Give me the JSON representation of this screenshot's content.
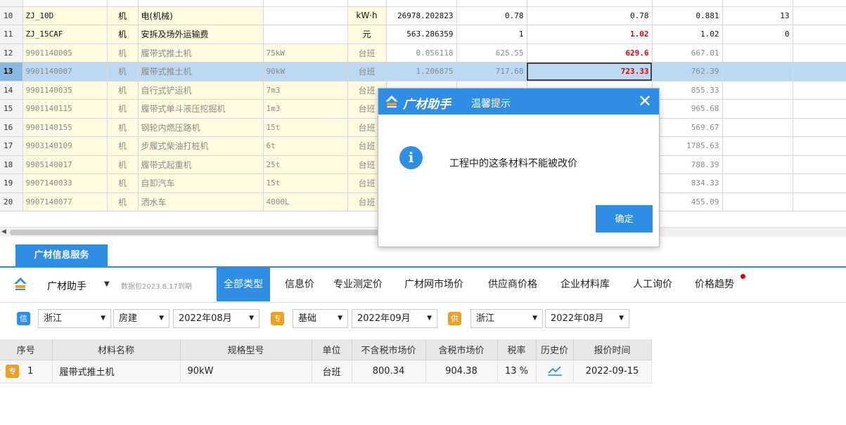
{
  "grid": {
    "rows": [
      {
        "no": "10",
        "code": "ZJ_10D",
        "cat": "机",
        "name": "电(机械)",
        "spec": "",
        "unit": "kW·h",
        "qty": "26978.202823",
        "p1": "0.78",
        "p2": "0.78",
        "p3": "0.881",
        "p4": "13"
      },
      {
        "no": "11",
        "code": "ZJ_15CAF",
        "cat": "机",
        "name": "安拆及场外运输费",
        "spec": "",
        "unit": "元",
        "qty": "563.286359",
        "p1": "1",
        "p2": "1.02",
        "p3": "1.02",
        "p4": "0"
      },
      {
        "no": "12",
        "code": "9901140005",
        "cat": "机",
        "name": "履带式推土机",
        "spec": "75kW",
        "unit": "台班",
        "qty": "0.056118",
        "p1": "625.55",
        "p2": "629.6",
        "p3": "667.01",
        "p4": ""
      },
      {
        "no": "13",
        "code": "9901140007",
        "cat": "机",
        "name": "履带式推土机",
        "spec": "90kW",
        "unit": "台班",
        "qty": "1.206875",
        "p1": "717.68",
        "p2": "723.33",
        "p3": "762.39",
        "p4": ""
      },
      {
        "no": "14",
        "code": "9901140035",
        "cat": "机",
        "name": "自行式铲运机",
        "spec": "7m3",
        "unit": "台班",
        "qty": "",
        "p1": "",
        "p2": "",
        "p3": "855.33",
        "p4": ""
      },
      {
        "no": "15",
        "code": "9901140115",
        "cat": "机",
        "name": "履带式单斗液压挖掘机",
        "spec": "1m3",
        "unit": "台班",
        "qty": "",
        "p1": "",
        "p2": "",
        "p3": "965.68",
        "p4": ""
      },
      {
        "no": "16",
        "code": "9901140155",
        "cat": "机",
        "name": "钢轮内燃压路机",
        "spec": "15t",
        "unit": "台班",
        "qty": "",
        "p1": "",
        "p2": "",
        "p3": "569.67",
        "p4": ""
      },
      {
        "no": "17",
        "code": "9903140109",
        "cat": "机",
        "name": "步履式柴油打桩机",
        "spec": "6t",
        "unit": "台班",
        "qty": "",
        "p1": "",
        "p2": "",
        "p3": "1785.63",
        "p4": ""
      },
      {
        "no": "18",
        "code": "9905140017",
        "cat": "机",
        "name": "履带式起重机",
        "spec": "25t",
        "unit": "台班",
        "qty": "",
        "p1": "",
        "p2": "",
        "p3": "788.39",
        "p4": ""
      },
      {
        "no": "19",
        "code": "9907140033",
        "cat": "机",
        "name": "自卸汽车",
        "spec": "15t",
        "unit": "台班",
        "qty": "",
        "p1": "",
        "p2": "",
        "p3": "834.33",
        "p4": ""
      },
      {
        "no": "20",
        "code": "9907140077",
        "cat": "机",
        "name": "洒水车",
        "spec": "4000L",
        "unit": "台班",
        "qty": "",
        "p1": "",
        "p2": "",
        "p3": "455.09",
        "p4": ""
      }
    ]
  },
  "service": {
    "tab_label": "广材信息服务",
    "assistant_label": "广材助手",
    "assistant_caret": "▼",
    "package_note": "数据包2023.8.17到期",
    "type_tabs": [
      "全部类型",
      "信息价",
      "专业测定价",
      "广材网市场价",
      "供应商价格",
      "企业材料库",
      "人工询价",
      "价格趋势"
    ]
  },
  "filters": {
    "badge_info": "信",
    "badge_pro": "专",
    "badge_supply": "供",
    "info_region": "浙江",
    "info_type": "房建",
    "info_period": "2022年08月",
    "pro_type": "基础",
    "pro_period": "2022年09月",
    "supply_region": "浙江",
    "supply_period": "2022年08月",
    "caret": "▼"
  },
  "price_table": {
    "headers": [
      "序号",
      "材料名称",
      "规格型号",
      "单位",
      "不含税市场价",
      "含税市场价",
      "税率",
      "历史价",
      "报价时间"
    ],
    "row": {
      "badge": "专",
      "no": "1",
      "name": "履带式推土机",
      "spec": "90kW",
      "unit": "台班",
      "price_ex": "800.34",
      "price_in": "904.38",
      "tax": "13 %",
      "date": "2022-09-15"
    }
  },
  "modal": {
    "brand": "广材助手",
    "title": "温馨提示",
    "close": "✕",
    "info_glyph": "i",
    "message": "工程中的这条材料不能被改价",
    "ok_label": "确定"
  },
  "colors": {
    "accent": "#2f8de4",
    "red_price": "#e00000",
    "selected_row": "#bcd8f2",
    "yellow_cell": "#fffbe0"
  }
}
